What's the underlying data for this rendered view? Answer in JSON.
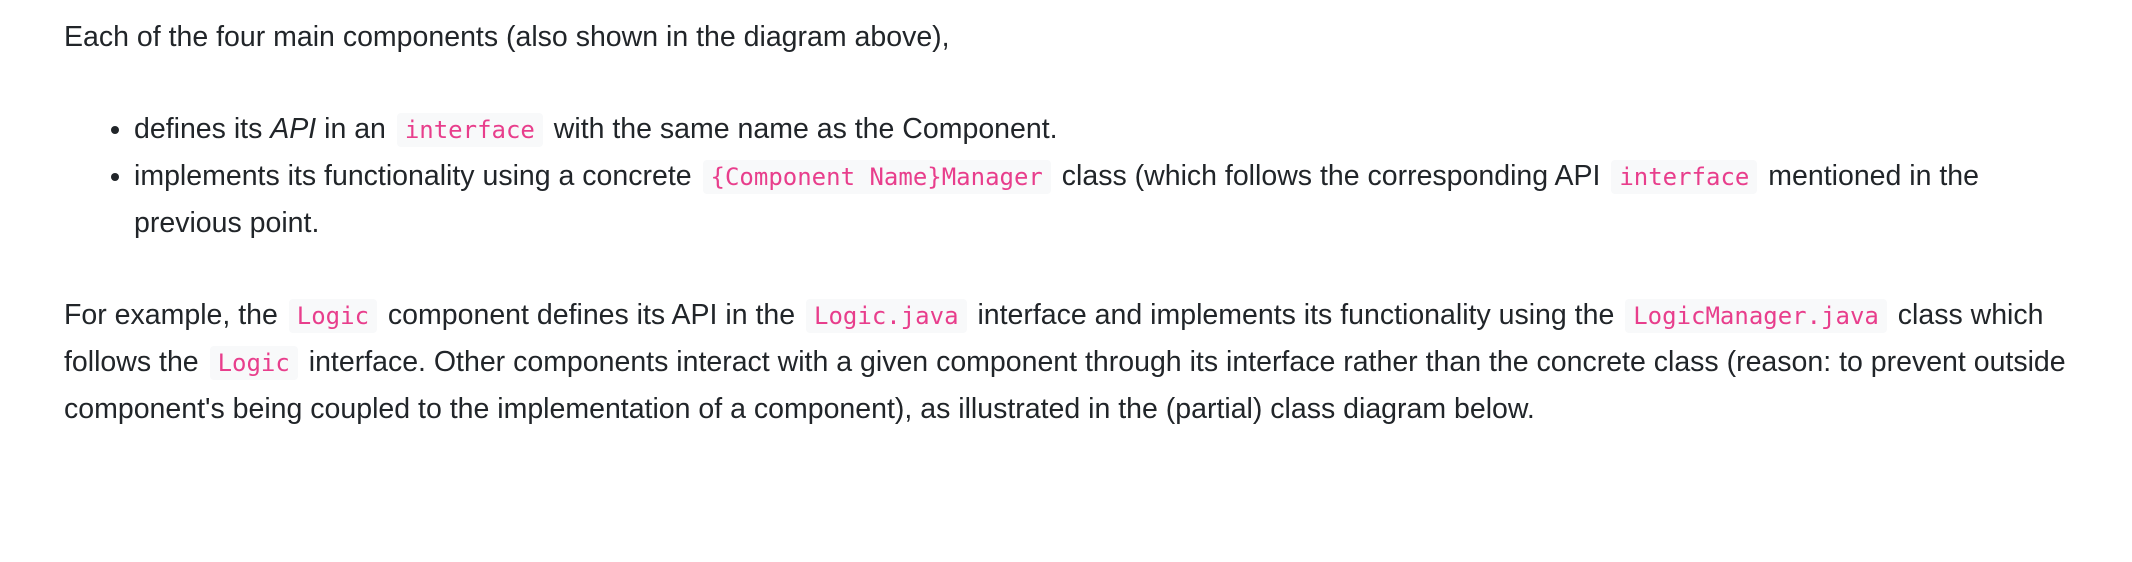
{
  "intro": "Each of the four main components (also shown in the diagram above),",
  "bullets": [
    {
      "text1": "defines its ",
      "em": "API",
      "text2": " in an ",
      "code1": "interface",
      "text3": " with the same name as the Component."
    },
    {
      "text1": "implements its functionality using a concrete ",
      "code1": "{Component Name}Manager",
      "text2": " class (which follows the corresponding API ",
      "code2": "interface",
      "text3": " mentioned in the previous point."
    }
  ],
  "example": {
    "t1": "For example, the ",
    "c1": "Logic",
    "t2": " component defines its API in the ",
    "c2": "Logic.java",
    "t3": " interface and implements its functionality using the ",
    "c3": "LogicManager.java",
    "t4": " class which follows the ",
    "c4": "Logic",
    "t5": " interface. Other components interact with a given component through its interface rather than the concrete class (reason: to prevent outside component's being coupled to the implementation of a component), as illustrated in the (partial) class diagram below."
  }
}
